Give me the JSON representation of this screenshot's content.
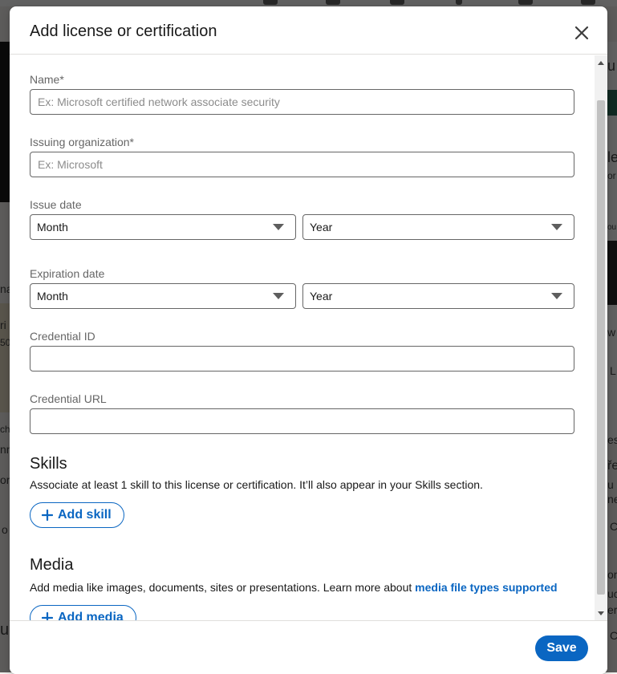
{
  "modal": {
    "title": "Add license or certification",
    "close_label": "close"
  },
  "form": {
    "name": {
      "label": "Name*",
      "placeholder": "Ex: Microsoft certified network associate security",
      "value": ""
    },
    "issuing_org": {
      "label": "Issuing organization*",
      "placeholder": "Ex: Microsoft",
      "value": ""
    },
    "issue_date": {
      "label": "Issue date",
      "month": "Month",
      "year": "Year"
    },
    "expiration_date": {
      "label": "Expiration date",
      "month": "Month",
      "year": "Year"
    },
    "credential_id": {
      "label": "Credential ID",
      "value": ""
    },
    "credential_url": {
      "label": "Credential URL",
      "value": ""
    }
  },
  "skills": {
    "title": "Skills",
    "description": "Associate at least 1 skill to this license or certification. It’ll also appear in your Skills section.",
    "add_label": "Add skill"
  },
  "media": {
    "title": "Media",
    "description": "Add media like images, documents, sites or presentations. Learn more about ",
    "link": "media file types supported",
    "add_label": "Add media"
  },
  "footer": {
    "save_label": "Save"
  },
  "background": {
    "fragments": [
      "na",
      "ri",
      "50",
      "ch",
      "nn",
      "ore",
      "o",
      "u",
      "u",
      "le",
      "or",
      "ou",
      "w",
      "L",
      "es",
      "ře",
      "u",
      "ne",
      "C",
      "on",
      "uc",
      "er",
      "C"
    ]
  },
  "colors": {
    "accent": "#0a66c2",
    "border": "#666666",
    "label": "#666666"
  }
}
